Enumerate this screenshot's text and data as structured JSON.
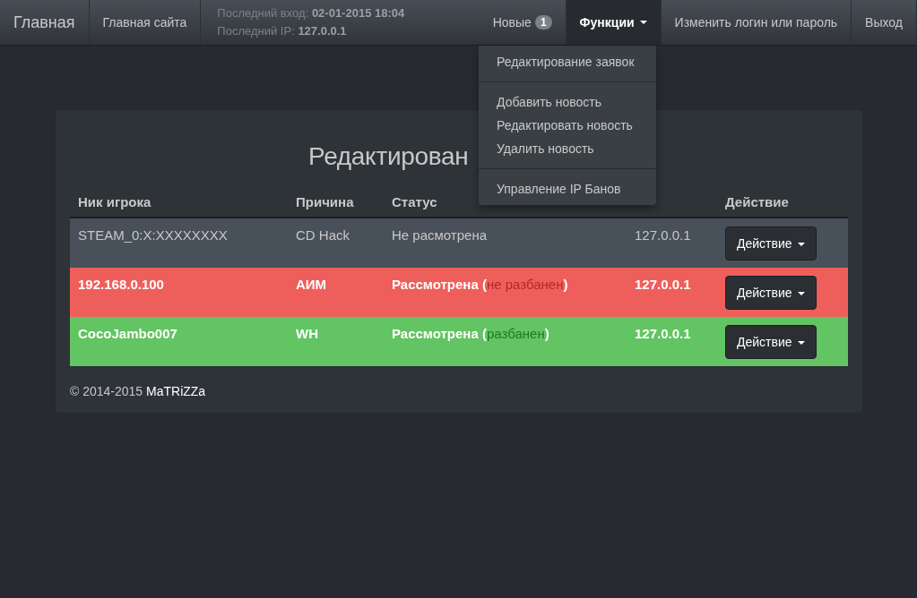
{
  "navbar": {
    "brand": "Главная",
    "links": [
      {
        "label": "Главная сайта"
      }
    ],
    "login_info": [
      {
        "label": "Последний вход:",
        "value": "02-01-2015 18:04"
      },
      {
        "label": "Последний IP:",
        "value": "127.0.0.1"
      }
    ],
    "right": [
      {
        "kind": "badge",
        "label": "Новые",
        "badge": "1",
        "selected": false
      },
      {
        "kind": "dropdown",
        "label": "Функции",
        "selected": true
      },
      {
        "kind": "link",
        "label": "Изменить логин или пароль",
        "selected": false
      },
      {
        "kind": "link",
        "label": "Выход",
        "selected": false
      }
    ]
  },
  "dropdown_menu": {
    "groups": [
      [
        "Редактирование заявок"
      ],
      [
        "Добавить новость",
        "Редактировать новость",
        "Удалить новость"
      ],
      [
        "Управление IP Банов"
      ]
    ]
  },
  "panel": {
    "title": "Редактирован",
    "columns": [
      "Ник игрока",
      "Причина",
      "Статус",
      "Действие"
    ],
    "rows": [
      {
        "kind": "pending",
        "player": "STEAM_0:X:XXXXXXXX",
        "reason": "CD Hack",
        "status": "Не расмотрена",
        "ip": "127.0.0.1",
        "action": "Действие"
      },
      {
        "kind": "not_banned",
        "player": "192.168.0.100",
        "reason": "АИМ",
        "status": "Рассмотрена (",
        "note": "не разбанен",
        "status_end": ")",
        "ip": "127.0.0.1",
        "action": "Действие"
      },
      {
        "kind": "banned",
        "player": "CocoJambo007",
        "reason": "WH",
        "status": "Рассмотрена (",
        "note": "разбанен",
        "status_end": ")",
        "ip": "127.0.0.1",
        "action": "Действие"
      }
    ],
    "footer": {
      "copyright": "© 2014-2015",
      "author": "MaTRiZZa"
    }
  }
}
